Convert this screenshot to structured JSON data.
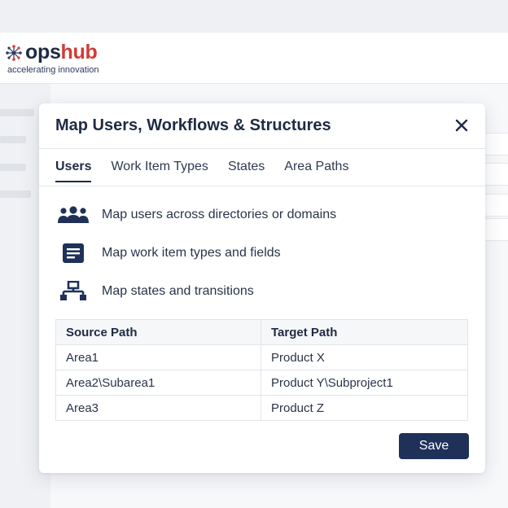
{
  "brand": {
    "name_part1": "ops",
    "name_part2": "hub",
    "tagline": "accelerating innovation",
    "color_dark": "#1f2a44",
    "color_accent": "#d23b35"
  },
  "modal": {
    "title": "Map Users, Workflows & Structures",
    "close_icon": "close-icon",
    "tabs": [
      {
        "label": "Users",
        "active": true
      },
      {
        "label": "Work Item Types",
        "active": false
      },
      {
        "label": "States",
        "active": false
      },
      {
        "label": "Area Paths",
        "active": false
      }
    ],
    "features": [
      {
        "icon": "users-group-icon",
        "text": "Map users across directories or domains"
      },
      {
        "icon": "document-list-icon",
        "text": "Map work item types and fields"
      },
      {
        "icon": "hierarchy-icon",
        "text": "Map states and transitions"
      }
    ],
    "table": {
      "headers": [
        "Source Path",
        "Target Path"
      ],
      "rows": [
        [
          "Area1",
          "Product X"
        ],
        [
          "Area2\\Subarea1",
          "Product Y\\Subproject1"
        ],
        [
          "Area3",
          "Product Z"
        ]
      ]
    },
    "save_label": "Save",
    "primary_color": "#1f3159"
  }
}
